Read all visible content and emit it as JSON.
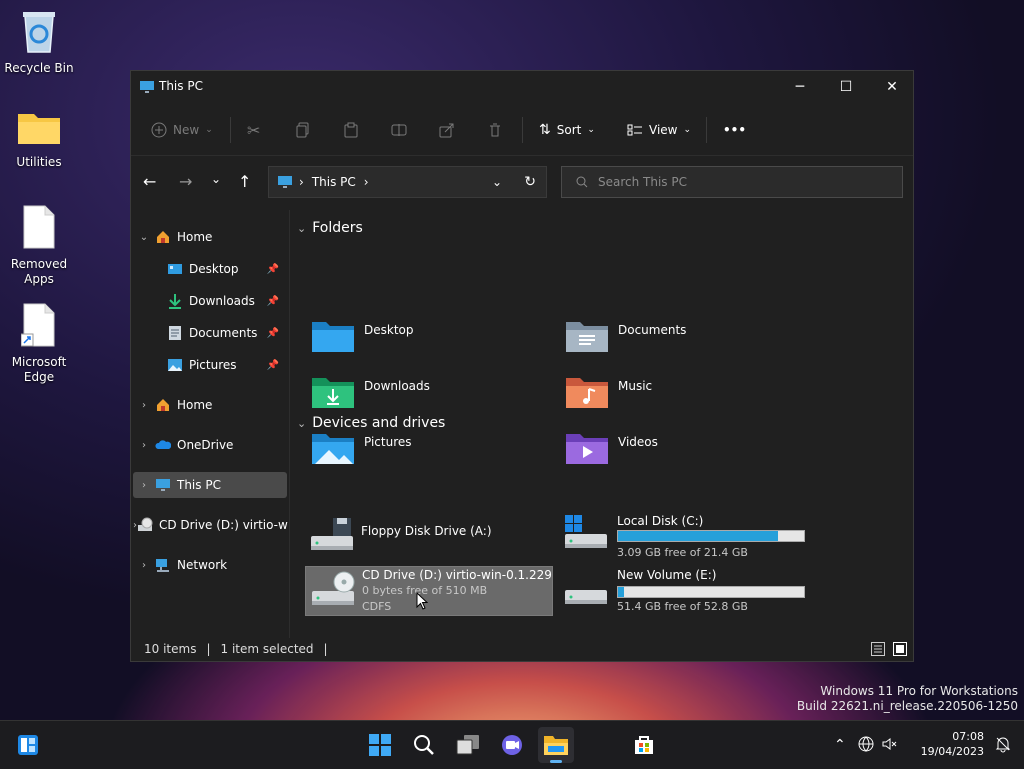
{
  "desktop": {
    "icons": [
      {
        "label": "Recycle Bin"
      },
      {
        "label": "Utilities"
      },
      {
        "label_line1": "Removed",
        "label_line2": "Apps"
      },
      {
        "label_line1": "Microsoft",
        "label_line2": "Edge"
      }
    ]
  },
  "window": {
    "title": "This PC",
    "controls": {
      "minimize": "─",
      "maximize": "☐",
      "close": "✕"
    }
  },
  "toolbar": {
    "new_label": "New",
    "sort_label": "Sort",
    "view_label": "View",
    "more_label": "•••"
  },
  "address_bar": {
    "location": "This PC",
    "separator": "›"
  },
  "search": {
    "placeholder": "Search This PC"
  },
  "sidebar": {
    "items": [
      {
        "label": "Home",
        "expanded": true
      },
      {
        "label": "Desktop",
        "pinned": true
      },
      {
        "label": "Downloads",
        "pinned": true
      },
      {
        "label": "Documents",
        "pinned": true
      },
      {
        "label": "Pictures",
        "pinned": true
      },
      {
        "label": "Home"
      },
      {
        "label": "OneDrive"
      },
      {
        "label": "This PC",
        "selected": true
      },
      {
        "label": "CD Drive (D:) virtio-w"
      },
      {
        "label": "Network"
      }
    ]
  },
  "content": {
    "folders_header": "Folders",
    "folders": [
      {
        "name": "Desktop"
      },
      {
        "name": "Documents"
      },
      {
        "name": "Downloads"
      },
      {
        "name": "Music"
      },
      {
        "name": "Pictures"
      },
      {
        "name": "Videos"
      }
    ],
    "devices_header": "Devices and drives",
    "drives": [
      {
        "name": "Floppy Disk Drive (A:)"
      },
      {
        "name": "Local Disk (C:)",
        "free_text": "3.09 GB free of 21.4 GB",
        "used_fraction": 0.86
      },
      {
        "name": "CD Drive (D:) virtio-win-0.1.229",
        "line2": "0 bytes free of 510 MB",
        "line3": "CDFS",
        "selected": true
      },
      {
        "name": "New Volume (E:)",
        "free_text": "51.4 GB free of 52.8 GB",
        "used_fraction": 0.03
      }
    ]
  },
  "statusbar": {
    "items_count": "10 items",
    "selection": "1 item selected"
  },
  "watermark": {
    "line1": "Windows 11 Pro for Workstations",
    "line2": "Build 22621.ni_release.220506-1250"
  },
  "taskbar": {
    "time": "07:08",
    "date": "19/04/2023"
  },
  "colors": {
    "accent": "#26a0da",
    "window_bg": "#202020",
    "selection": "#4a4a4a"
  }
}
